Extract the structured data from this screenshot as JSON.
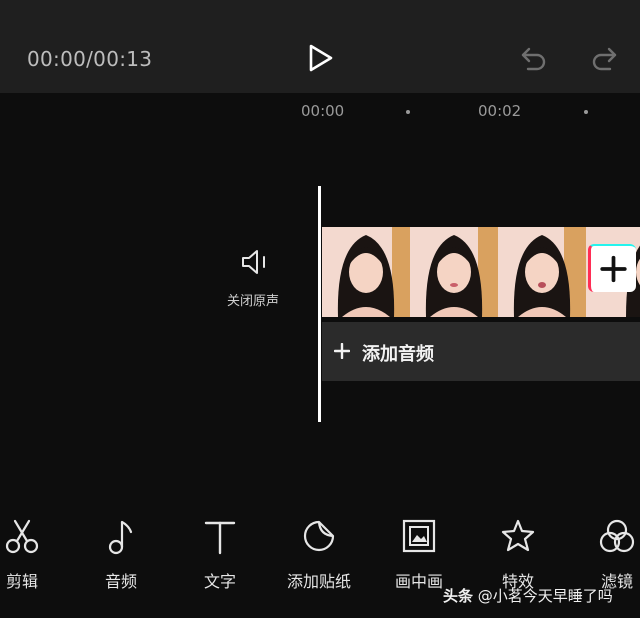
{
  "header": {
    "timecode": "00:00/00:13",
    "icons": {
      "play": "play-icon",
      "undo": "undo-icon",
      "redo": "redo-icon"
    }
  },
  "ruler": {
    "labels": [
      "00:00",
      "00:02"
    ]
  },
  "track": {
    "mute_label": "关闭原声",
    "add_audio_label": "添加音频"
  },
  "toolbar": {
    "items": [
      {
        "label": "剪辑",
        "icon": "scissors-icon"
      },
      {
        "label": "音频",
        "icon": "music-note-icon"
      },
      {
        "label": "文字",
        "icon": "text-icon"
      },
      {
        "label": "添加贴纸",
        "icon": "sticker-icon"
      },
      {
        "label": "画中画",
        "icon": "picture-in-picture-icon"
      },
      {
        "label": "特效",
        "icon": "effects-star-icon"
      },
      {
        "label": "滤镜",
        "icon": "filter-icon"
      }
    ]
  },
  "watermark": {
    "brand": "头条",
    "handle": "@小茗今天早睡了吗"
  },
  "colors": {
    "background": "#0d0d0d",
    "topbar": "#1f1f1f",
    "audio_track": "#2b2b2b",
    "accent_red": "#ff2d55",
    "accent_cyan": "#25f4ee"
  }
}
